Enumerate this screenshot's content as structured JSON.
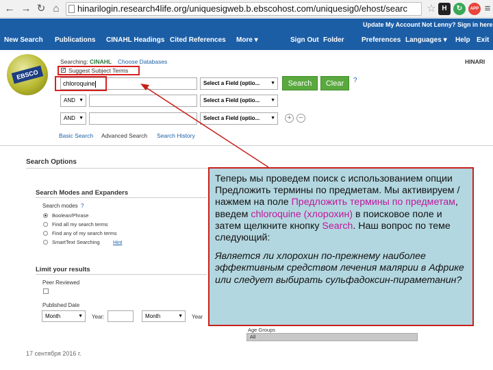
{
  "browser": {
    "url": "hinarilogin.research4life.org/uniquesigweb.b.ebscohost.com/uniquesig0/ehost/searc",
    "url_domain": "hinarilogin.research4life.org",
    "ext_h": "H",
    "ext_app": "APP"
  },
  "topnav": {
    "update_account": "Update My Account",
    "not_user": "Not Lenny?",
    "sign_in": "Sign in here",
    "items": [
      "New Search",
      "Publications",
      "CINAHL Headings",
      "Cited References",
      "More ▾",
      "Sign Out",
      "Folder",
      "Preferences",
      "Languages ▾",
      "Help",
      "Exit"
    ]
  },
  "search": {
    "searching_label": "Searching:",
    "database": "CINAHL",
    "choose_db": "Choose Databases",
    "suggest_terms": "Suggest Subject Terms",
    "query_value": "chloroquine",
    "field_placeholder": "Select a Field (optio...",
    "op1": "AND",
    "op2": "AND",
    "search_btn": "Search",
    "clear_btn": "Clear",
    "help": "?",
    "basic": "Basic Search",
    "advanced": "Advanced Search",
    "history": "Search History",
    "brand": "HINARI",
    "logo": "EBSCO"
  },
  "options": {
    "title": "Search Options",
    "modes_title": "Search Modes and Expanders",
    "mode_label": "Search modes",
    "modes": [
      "Boolean/Phrase",
      "Find all my search terms",
      "Find any of my search terms",
      "SmartText Searching"
    ],
    "hint": "Hint",
    "limit_title": "Limit your results",
    "peer_reviewed": "Peer Reviewed",
    "pub_date": "Published Date",
    "month1": "Month",
    "year_label": "Year:",
    "month2": "Month",
    "year2": "Year",
    "age_groups": "Age Groups",
    "all": "All"
  },
  "callout": {
    "line1": "Теперь мы проведем поиск с использованием опции Предложить термины по предметам. Мы активируем /нажмем на поле ",
    "hl1": "Предложить термины по предметам",
    "line2": ", введем ",
    "hl2": "chloroquine (хлорохин)",
    "line3": " в поисковое поле и затем щелкните кнопку ",
    "hl3": "Search",
    "line4": ".  Наш вопрос по теме следующий:",
    "question": "Является ли хлорохин по-прежнему наиболее эффективным средством лечения малярии в Африке или следует выбирать сульфадоксин-пираметанин?"
  },
  "footer": {
    "date": "17 сентября 2016 г."
  },
  "colors": {
    "nav_blue": "#1c5ea6",
    "button_green": "#59a93e",
    "callout_bg": "#b3d7e0",
    "annotation_red": "#d62020",
    "highlight_magenta": "#c0169b"
  }
}
